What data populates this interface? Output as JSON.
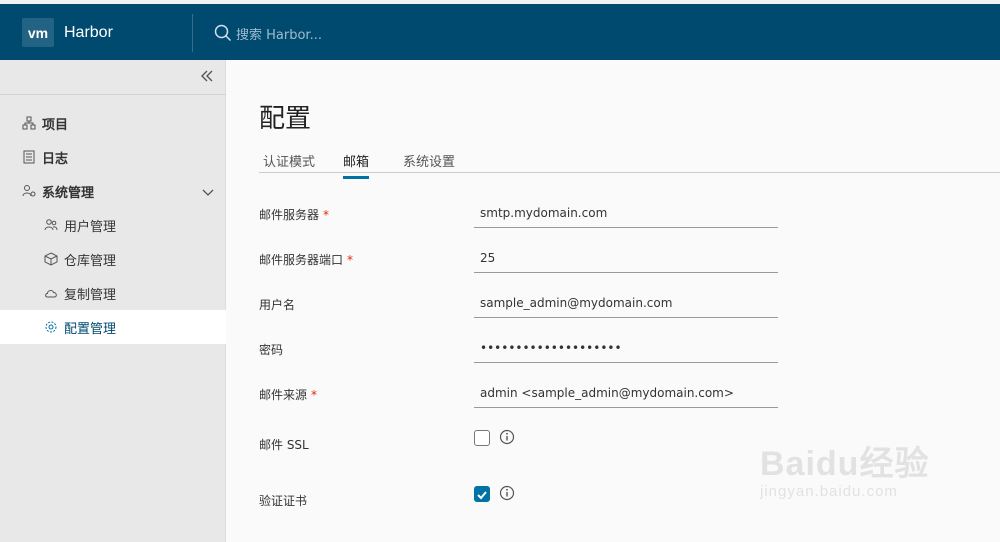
{
  "header": {
    "logo_text": "vm",
    "app_name": "Harbor",
    "search_placeholder": "搜索 Harbor..."
  },
  "sidebar": {
    "collapse_icon": "double-chevron-left-icon",
    "items": [
      {
        "label": "项目",
        "icon": "project-icon"
      },
      {
        "label": "日志",
        "icon": "log-icon"
      },
      {
        "label": "系统管理",
        "icon": "admin-icon"
      },
      {
        "label": "用户管理",
        "icon": "users-icon"
      },
      {
        "label": "仓库管理",
        "icon": "box-icon"
      },
      {
        "label": "复制管理",
        "icon": "cloud-icon"
      },
      {
        "label": "配置管理",
        "icon": "gear-icon"
      }
    ],
    "active_item": "配置管理"
  },
  "main": {
    "title": "配置",
    "tabs": [
      {
        "label": "认证模式"
      },
      {
        "label": "邮箱"
      },
      {
        "label": "系统设置"
      }
    ],
    "active_tab": "邮箱",
    "form": {
      "email_server": {
        "label": "邮件服务器",
        "value": "smtp.mydomain.com",
        "required": "*"
      },
      "email_port": {
        "label": "邮件服务器端口",
        "value": "25",
        "required": "*"
      },
      "username": {
        "label": "用户名",
        "value": "sample_admin@mydomain.com"
      },
      "password": {
        "label": "密码",
        "value": "••••••••••••••••••••"
      },
      "email_from": {
        "label": "邮件来源",
        "value": "admin <sample_admin@mydomain.com>",
        "required": "*"
      },
      "email_ssl": {
        "label": "邮件 SSL",
        "checked": false
      },
      "verify_cert": {
        "label": "验证证书",
        "checked": true
      }
    }
  },
  "watermark": {
    "line1": "Baidu经验",
    "line2": "jingyan.baidu.com"
  },
  "colors": {
    "header_bg": "#004a70",
    "accent": "#0072a3",
    "required": "#e62700"
  }
}
